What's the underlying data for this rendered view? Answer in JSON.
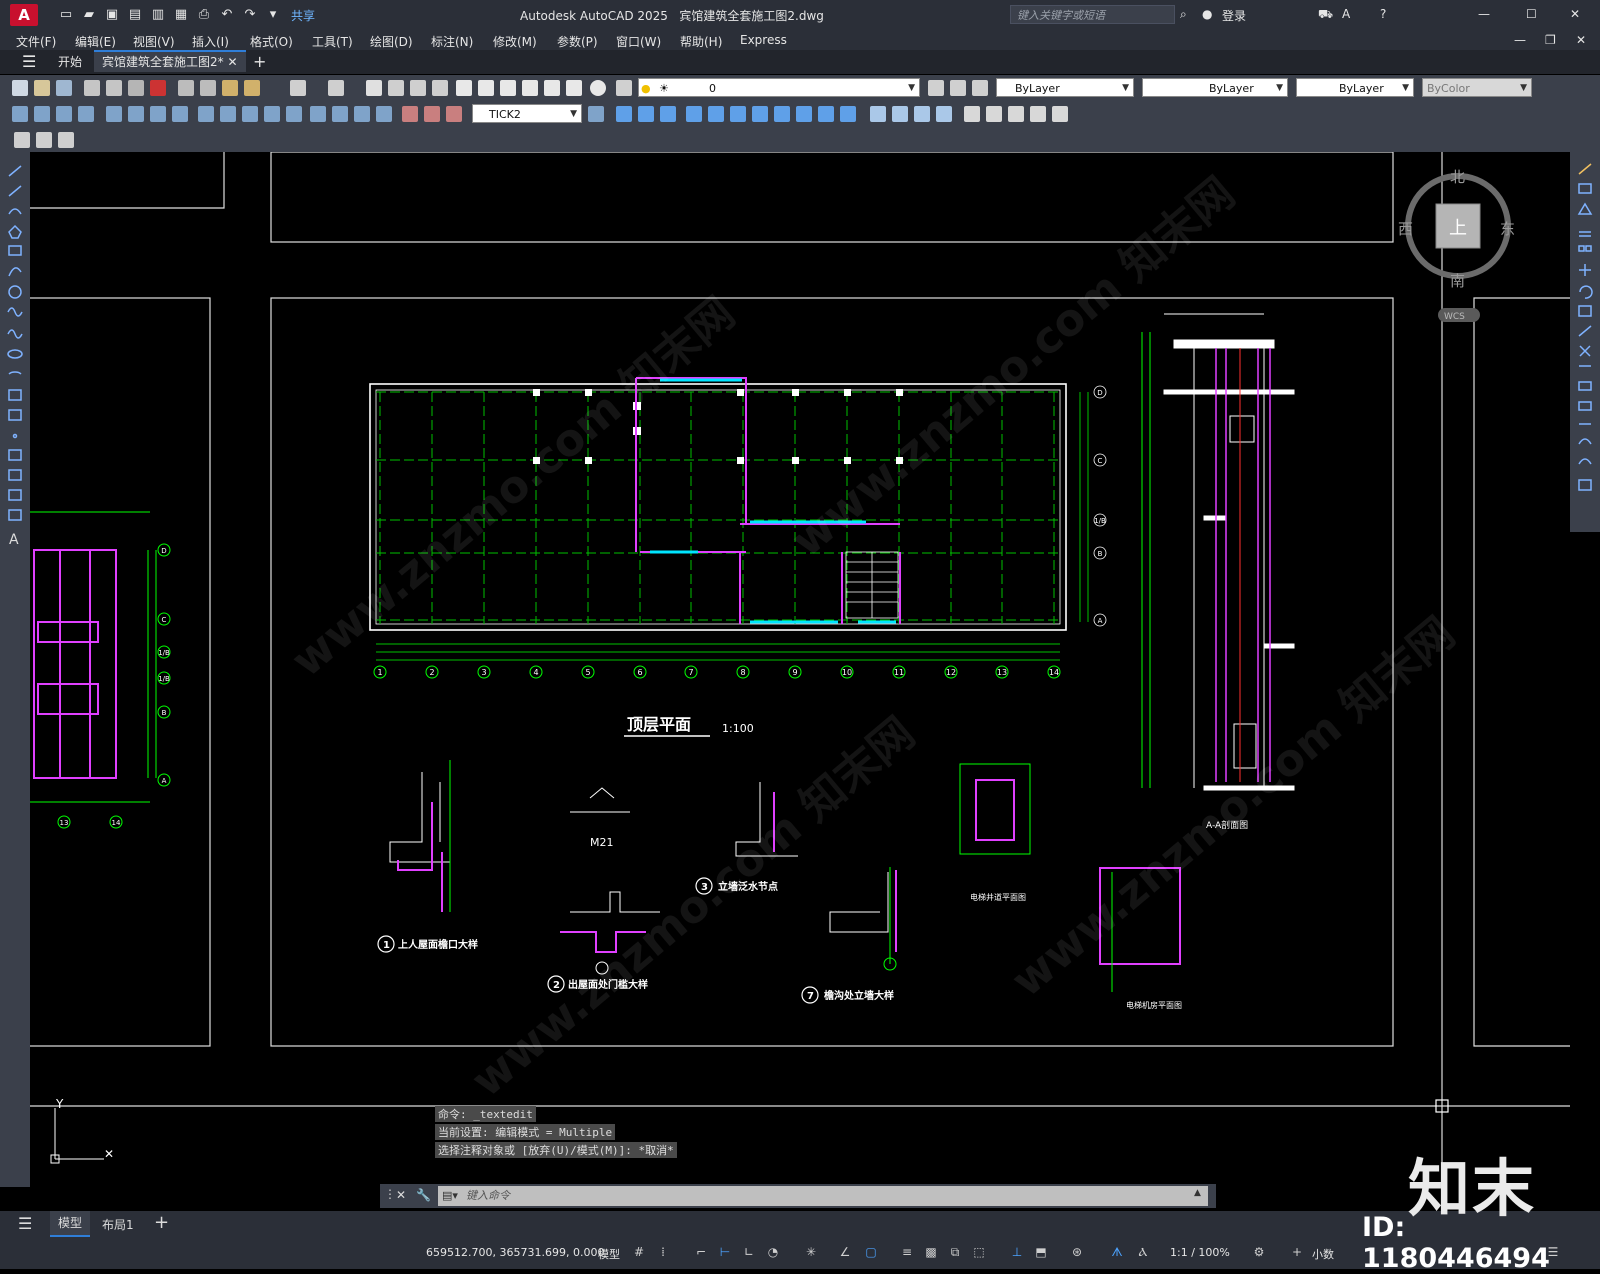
{
  "app": {
    "title": "Autodesk AutoCAD 2025",
    "filename": "宾馆建筑全套施工图2.dwg",
    "search_placeholder": "键入关键字或短语",
    "login": "登录",
    "share": "共享",
    "logo": "A"
  },
  "menu": [
    "文件(F)",
    "编辑(E)",
    "视图(V)",
    "插入(I)",
    "格式(O)",
    "工具(T)",
    "绘图(D)",
    "标注(N)",
    "修改(M)",
    "参数(P)",
    "窗口(W)",
    "帮助(H)",
    "Express"
  ],
  "tabs": {
    "start": "开始",
    "doc": "宾馆建筑全套施工图2*"
  },
  "properties": {
    "layer": "0",
    "color": "ByLayer",
    "linetype": "ByLayer",
    "lineweight": "ByLayer",
    "plotstyle": "ByColor",
    "dimstyle": "TICK2"
  },
  "viewcube": {
    "north": "北",
    "south": "南",
    "east": "东",
    "west": "西",
    "face": "上",
    "wcs": "WCS"
  },
  "drawing": {
    "plan_title": "顶层平面",
    "plan_scale": "1:100",
    "section_title": "A-A剖面图",
    "detail1": "上人屋面檐口大样",
    "detail2": "出屋面处门槛大样",
    "detail3": "立墙泛水节点",
    "detail7": "檐沟处立墙大样",
    "detail_m21": "M21",
    "elevator_shaft": "电梯井道平面图",
    "elevator_room": "电梯机房平面图",
    "axis_numbers": [
      "1",
      "2",
      "3",
      "4",
      "5",
      "6",
      "7",
      "8",
      "9",
      "10",
      "11",
      "12",
      "13",
      "14"
    ],
    "axis_letters": [
      "D",
      "C",
      "1/B",
      "B",
      "A"
    ],
    "left_axis_letters": [
      "D",
      "C",
      "1/B",
      "1/B",
      "B",
      "A"
    ],
    "left_axis_numbers": [
      "13",
      "14"
    ]
  },
  "command": {
    "history": [
      "命令: _textedit",
      "当前设置: 编辑模式 = Multiple",
      "选择注释对象或 [放弃(U)/模式(M)]: *取消*"
    ],
    "prompt": "键入命令"
  },
  "layout_tabs": {
    "model": "模型",
    "layout1": "布局1"
  },
  "status": {
    "coordinates": "659512.700, 365731.699, 0.000",
    "space": "模型",
    "scale": "1:1 / 100%",
    "units": "小数"
  },
  "watermark": {
    "brand": "知末",
    "id": "ID: 1180446494",
    "text": "www.znzmo.com 知末网"
  }
}
